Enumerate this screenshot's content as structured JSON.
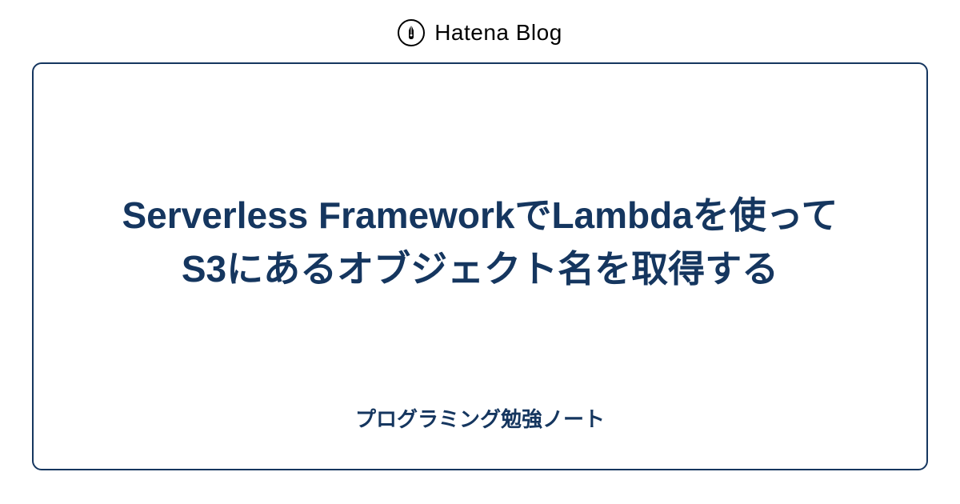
{
  "header": {
    "brand_name": "Hatena Blog"
  },
  "card": {
    "article_title": "Serverless FrameworkでLambdaを使ってS3にあるオブジェクト名を取得する",
    "blog_name": "プログラミング勉強ノート"
  },
  "colors": {
    "primary": "#15365f",
    "background": "#ffffff",
    "text_black": "#000000"
  }
}
